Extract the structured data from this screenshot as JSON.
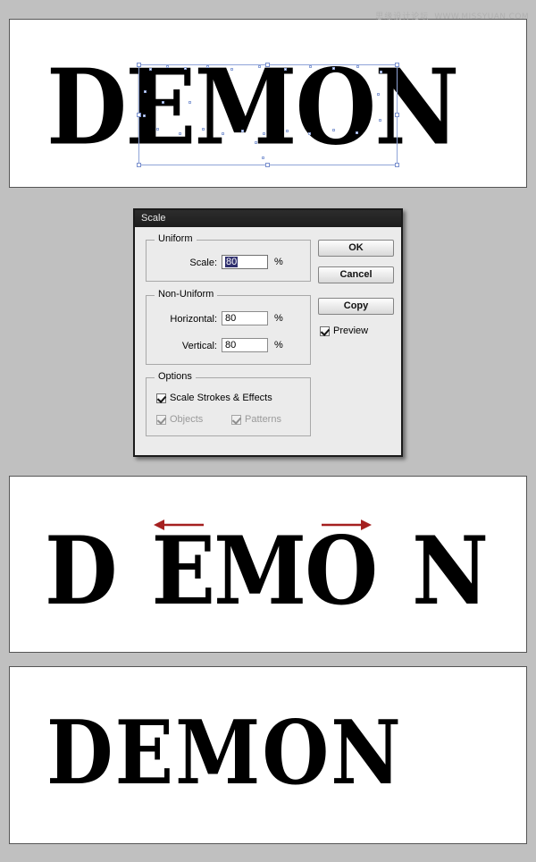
{
  "watermark": {
    "cn_text": "思缘设计论坛",
    "url_text": "WWW.MISSYUAN.COM"
  },
  "canvas_panels": [
    {
      "name": "artwork-before-scale",
      "wordmark": "DEMON",
      "letters": [
        "D",
        "E",
        "M",
        "O",
        "N"
      ],
      "selection": {
        "present": true,
        "selected_letters": "EMO",
        "handle_color": "#8fa4d8"
      },
      "arrows": []
    },
    {
      "name": "artwork-after-scale-with-gaps",
      "wordmark": "D EMO N",
      "letters": [
        "D",
        "E",
        "M",
        "O",
        "N"
      ],
      "selection": {
        "present": false
      },
      "arrows": [
        {
          "direction": "left",
          "color": "#a52020"
        },
        {
          "direction": "right",
          "color": "#a52020"
        }
      ]
    },
    {
      "name": "artwork-final-kerned",
      "wordmark": "DEMON",
      "letters": [
        "D",
        "E",
        "M",
        "O",
        "N"
      ],
      "selection": {
        "present": false
      },
      "arrows": []
    }
  ],
  "dialog": {
    "title": "Scale",
    "uniform": {
      "legend": "Uniform",
      "radio_selected": true,
      "scale_label": "Scale:",
      "scale_value": "80",
      "scale_value_selected": true,
      "percent_symbol": "%"
    },
    "non_uniform": {
      "legend": "Non-Uniform",
      "radio_selected": false,
      "horizontal_label": "Horizontal:",
      "horizontal_value": "80",
      "horizontal_percent": "%",
      "vertical_label": "Vertical:",
      "vertical_value": "80",
      "vertical_percent": "%"
    },
    "options": {
      "legend": "Options",
      "items": [
        {
          "label": "Scale Strokes & Effects",
          "checked": true,
          "disabled": false
        },
        {
          "label": "Objects",
          "checked": true,
          "disabled": true
        },
        {
          "label": "Patterns",
          "checked": true,
          "disabled": true
        }
      ]
    },
    "buttons": {
      "ok": "OK",
      "cancel": "Cancel",
      "copy": "Copy"
    },
    "preview": {
      "label": "Preview",
      "checked": true
    }
  },
  "colors": {
    "background": "#c0c0c0",
    "canvas": "#ffffff",
    "dialog_face": "#ebebeb",
    "titlebar": "#242424",
    "selection_highlight": "#2f2f6e",
    "arrow_red": "#a52020",
    "handle_blue": "#8fa4d8"
  }
}
